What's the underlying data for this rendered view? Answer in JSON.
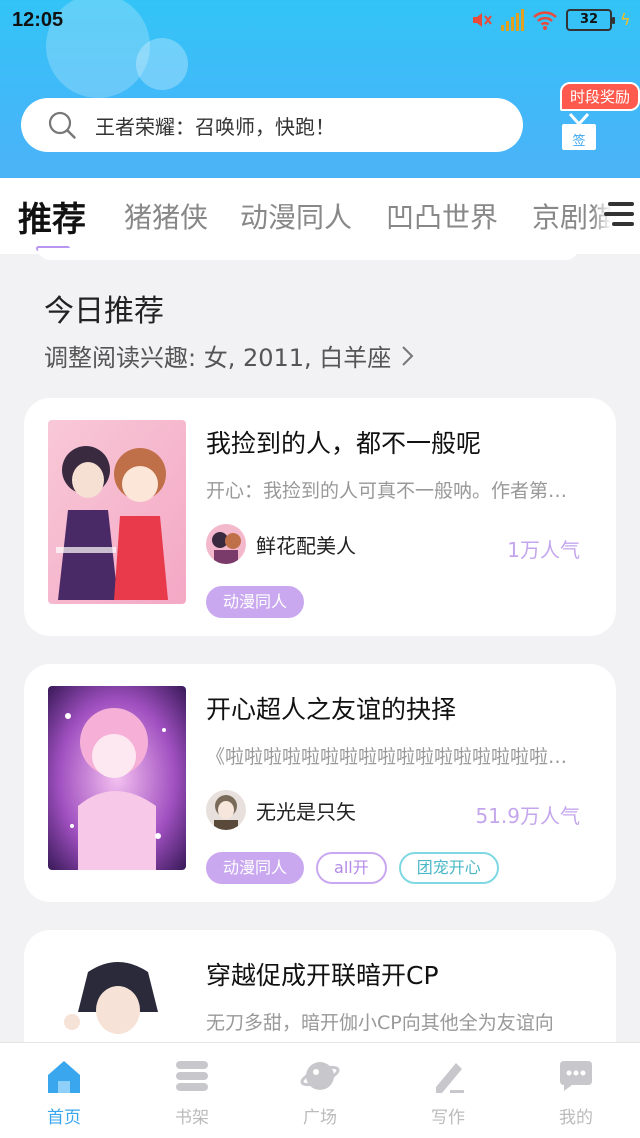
{
  "status_bar": {
    "time": "12:05",
    "battery": "32"
  },
  "search": {
    "placeholder": "王者荣耀：召唤师，快跑！"
  },
  "reward": {
    "badge": "时段奖励",
    "gift_label": "签"
  },
  "tabs": [
    {
      "label": "推荐",
      "active": true
    },
    {
      "label": "猪猪侠"
    },
    {
      "label": "动漫同人"
    },
    {
      "label": "凹凸世界"
    },
    {
      "label": "京剧猫"
    }
  ],
  "section": {
    "title": "今日推荐",
    "subtitle": "调整阅读兴趣: 女, 2011, 白羊座"
  },
  "cards": [
    {
      "title": "我捡到的人，都不一般呢",
      "desc": "开心：我捡到的人可真不一般呐。作者第…",
      "author": "鲜花配美人",
      "popularity": "1万人气",
      "tags": [
        "动漫同人"
      ]
    },
    {
      "title": "开心超人之友谊的抉择",
      "desc": "《啦啦啦啦啦啦啦啦啦啦啦啦啦啦啦啦啦…",
      "author": "无光是只矢",
      "popularity": "51.9万人气",
      "tags": [
        "动漫同人",
        "all开",
        "团宠开心"
      ]
    },
    {
      "title": "穿越促成开联暗开CP",
      "desc": "无刀多甜，暗开伽小CP向其他全为友谊向"
    }
  ],
  "bottom_nav": [
    {
      "label": "首页",
      "icon": "home-icon",
      "active": true
    },
    {
      "label": "书架",
      "icon": "bookshelf-icon"
    },
    {
      "label": "广场",
      "icon": "planet-icon"
    },
    {
      "label": "写作",
      "icon": "pen-icon"
    },
    {
      "label": "我的",
      "icon": "chat-icon"
    }
  ],
  "colors": {
    "accent": "#3aa6ee",
    "tab_indicator": "#b795f0",
    "tag_purple": "#c9a8f0",
    "tag_teal": "#7fd8e4"
  }
}
